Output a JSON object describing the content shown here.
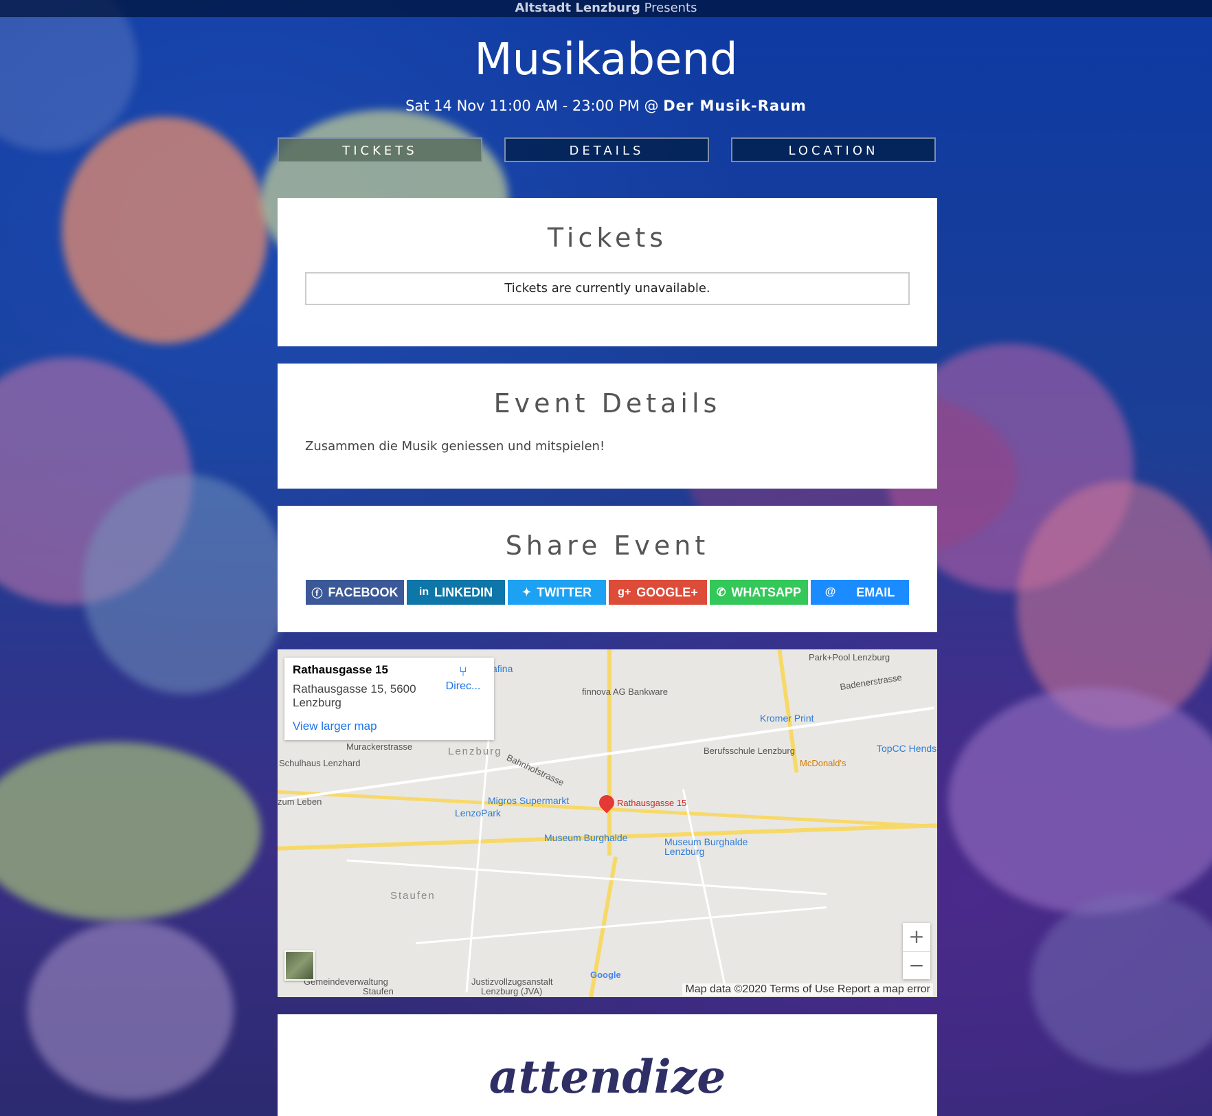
{
  "topbar": {
    "organizer": "Altstadt Lenzburg",
    "suffix": "Presents"
  },
  "event": {
    "title": "Musikabend",
    "datetime": "Sat 14 Nov 11:00 AM - 23:00 PM @",
    "venue": "Der Musik-Raum"
  },
  "nav": {
    "tickets": "TICKETS",
    "details": "DETAILS",
    "location": "LOCATION"
  },
  "tickets": {
    "heading": "Tickets",
    "message": "Tickets are currently unavailable."
  },
  "details": {
    "heading": "Event Details",
    "description": "Zusammen die Musik geniessen und mitspielen!"
  },
  "share": {
    "heading": "Share Event",
    "buttons": [
      {
        "label": "FACEBOOK",
        "icon": "facebook-icon",
        "color": "#3b5998"
      },
      {
        "label": "LINKEDIN",
        "icon": "linkedin-icon",
        "color": "#0e76a8"
      },
      {
        "label": "TWITTER",
        "icon": "twitter-icon",
        "color": "#1da1f2"
      },
      {
        "label": "GOOGLE+",
        "icon": "google-plus-icon",
        "color": "#dd4b39"
      },
      {
        "label": "WHATSAPP",
        "icon": "whatsapp-icon",
        "color": "#34c759"
      },
      {
        "label": "EMAIL",
        "icon": "email-icon",
        "color": "#1a8cff"
      }
    ]
  },
  "map": {
    "card_title": "Rathausgasse 15",
    "card_address_1": "Rathausgasse 15, 5600",
    "card_address_2": "Lenzburg",
    "directions": "Direc...",
    "larger_map": "View larger map",
    "marker_label": "Rathausgasse 15",
    "labels": {
      "park_pool": "Park+Pool Lenzburg",
      "badenerstrasse": "Badenerstrasse",
      "finnova": "finnova AG Bankware",
      "kromer": "Kromer Print",
      "topcc": "TopCC Hends",
      "berufsschule": "Berufsschule Lenzburg",
      "mcdonalds": "McDonald's",
      "lenzburg": "Lenzburg",
      "muracker": "Murackerstrasse",
      "schulhaus": "Schulhaus Lenzhard",
      "bahnhof": "Bahnhofstrasse",
      "migros": "Migros Supermarkt",
      "lenzopark": "LenzoPark",
      "museum1": "Museum Burghalde",
      "museum2a": "Museum Burghalde",
      "museum2b": "Lenzburg",
      "zum_leben": "zum Leben",
      "staufen": "Staufen",
      "gemeinde1": "Gemeindeverwaltung",
      "gemeinde2": "Staufen",
      "justiz1": "Justizvollzugsanstalt",
      "justiz2": "Lenzburg (JVA)",
      "afina": "afina",
      "google": "Google"
    },
    "zoom_in": "+",
    "zoom_out": "−",
    "attribution": "Map data ©2020   Terms of Use   Report a map error"
  },
  "footer": {
    "logo": "attendize"
  }
}
